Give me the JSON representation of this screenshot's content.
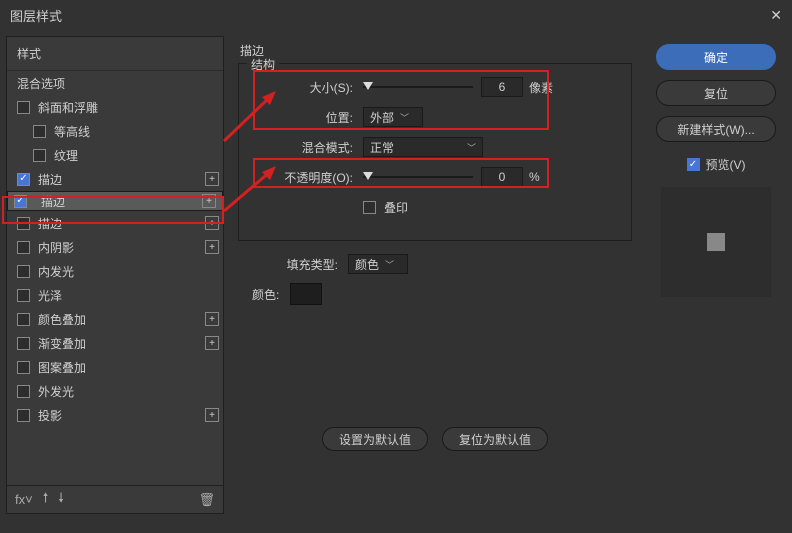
{
  "window": {
    "title": "图层样式"
  },
  "sidebar": {
    "header": "样式",
    "blend_options": "混合选项",
    "items": [
      {
        "label": "斜面和浮雕",
        "checked": false,
        "indent": false,
        "plus": false
      },
      {
        "label": "等高线",
        "checked": false,
        "indent": true,
        "plus": false
      },
      {
        "label": "纹理",
        "checked": false,
        "indent": true,
        "plus": false
      },
      {
        "label": "描边",
        "checked": true,
        "indent": false,
        "plus": true
      },
      {
        "label": "描边",
        "checked": true,
        "indent": false,
        "plus": true,
        "selected": true
      },
      {
        "label": "描边",
        "checked": false,
        "indent": false,
        "plus": true
      },
      {
        "label": "内阴影",
        "checked": false,
        "indent": false,
        "plus": true
      },
      {
        "label": "内发光",
        "checked": false,
        "indent": false,
        "plus": false
      },
      {
        "label": "光泽",
        "checked": false,
        "indent": false,
        "plus": false
      },
      {
        "label": "颜色叠加",
        "checked": false,
        "indent": false,
        "plus": true
      },
      {
        "label": "渐变叠加",
        "checked": false,
        "indent": false,
        "plus": true
      },
      {
        "label": "图案叠加",
        "checked": false,
        "indent": false,
        "plus": false
      },
      {
        "label": "外发光",
        "checked": false,
        "indent": false,
        "plus": false
      },
      {
        "label": "投影",
        "checked": false,
        "indent": false,
        "plus": true
      }
    ]
  },
  "panel": {
    "title": "描边",
    "structure_legend": "结构",
    "size_label": "大小(S):",
    "size_value": "6",
    "size_unit": "像素",
    "position_label": "位置:",
    "position_value": "外部",
    "blend_mode_label": "混合模式:",
    "blend_mode_value": "正常",
    "opacity_label": "不透明度(O):",
    "opacity_value": "0",
    "opacity_unit": "%",
    "overprint_label": "叠印",
    "fill_type_label": "填充类型:",
    "fill_type_value": "颜色",
    "color_label": "颜色:",
    "btn_default": "设置为默认值",
    "btn_reset": "复位为默认值"
  },
  "right": {
    "ok": "确定",
    "cancel": "复位",
    "new_style": "新建样式(W)...",
    "preview": "预览(V)"
  }
}
